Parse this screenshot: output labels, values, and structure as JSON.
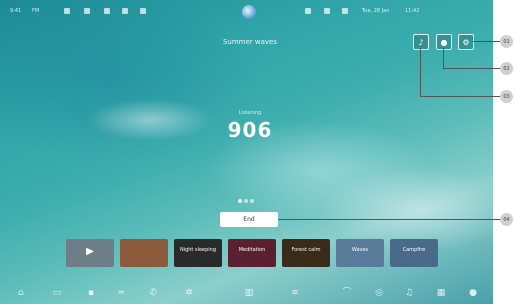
{
  "status_bar": {
    "left": [
      "9:41",
      "FM"
    ],
    "right": [
      "Tue, 28 Jan",
      "11:42"
    ]
  },
  "header": {
    "title": "Summer waves"
  },
  "top_buttons": {
    "music_icon": "♪",
    "record_icon": "●",
    "settings_icon": "⚙"
  },
  "center": {
    "sub_label": "Listening",
    "big_number": "906"
  },
  "end_button": {
    "label": "End"
  },
  "thumbnails": [
    {
      "label": "",
      "color": "#6e7d86"
    },
    {
      "label": "",
      "color": "#8a5a3a"
    },
    {
      "label": "Night sleeping",
      "color": "#2a2a2a"
    },
    {
      "label": "Meditation",
      "color": "#5a2030"
    },
    {
      "label": "Forest calm",
      "color": "#3a2a1a"
    },
    {
      "label": "Waves",
      "color": "#5a7a9a"
    },
    {
      "label": "Campfire",
      "color": "#4a6a8a"
    }
  ],
  "callouts": [
    "01",
    "02",
    "03",
    "04"
  ]
}
